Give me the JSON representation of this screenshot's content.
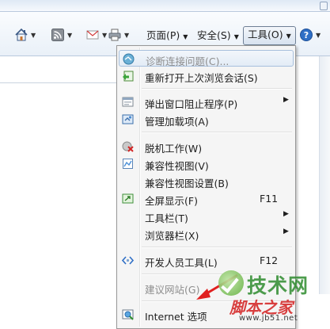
{
  "toolbar": {
    "buttons": [
      {
        "icon": "home-icon"
      },
      {
        "icon": "feeds-icon"
      },
      {
        "icon": "mail-icon"
      },
      {
        "icon": "print-icon"
      },
      {
        "label": "页面(P)"
      },
      {
        "label": "安全(S)"
      },
      {
        "label": "工具(O)"
      },
      {
        "icon": "help-icon"
      }
    ]
  },
  "menu": {
    "items": [
      {
        "label": "诊断连接问题(C)...",
        "disabled": true,
        "icon": "diagnose-icon"
      },
      {
        "label": "重新打开上次浏览会话(S)",
        "icon": "reopen-session-icon"
      },
      {
        "label": "弹出窗口阻止程序(P)",
        "submenu": true,
        "icon": "popup-blocker-icon"
      },
      {
        "label": "管理加载项(A)",
        "icon": "addons-icon"
      },
      {
        "label": "脱机工作(W)",
        "icon": "offline-icon"
      },
      {
        "label": "兼容性视图(V)",
        "icon": "compat-view-icon"
      },
      {
        "label": "兼容性视图设置(B)"
      },
      {
        "label": "全屏显示(F)",
        "shortcut": "F11",
        "icon": "fullscreen-icon"
      },
      {
        "label": "工具栏(T)",
        "submenu": true
      },
      {
        "label": "浏览器栏(X)",
        "submenu": true
      },
      {
        "label": "开发人员工具(L)",
        "shortcut": "F12",
        "icon": "devtools-icon"
      },
      {
        "label": "建议网站(G)",
        "disabled": true
      },
      {
        "label": "Internet 选项",
        "icon": "internet-options-icon"
      }
    ]
  },
  "watermark": {
    "line1": "技术网",
    "line2": "脚本之家",
    "line3": "www.jb51.net"
  },
  "colors": {
    "menu_bg": "#f5f5f5",
    "highlight_border": "#a8c0dd",
    "watermark_green": "#2f8c2f",
    "watermark_red": "#d32020"
  }
}
